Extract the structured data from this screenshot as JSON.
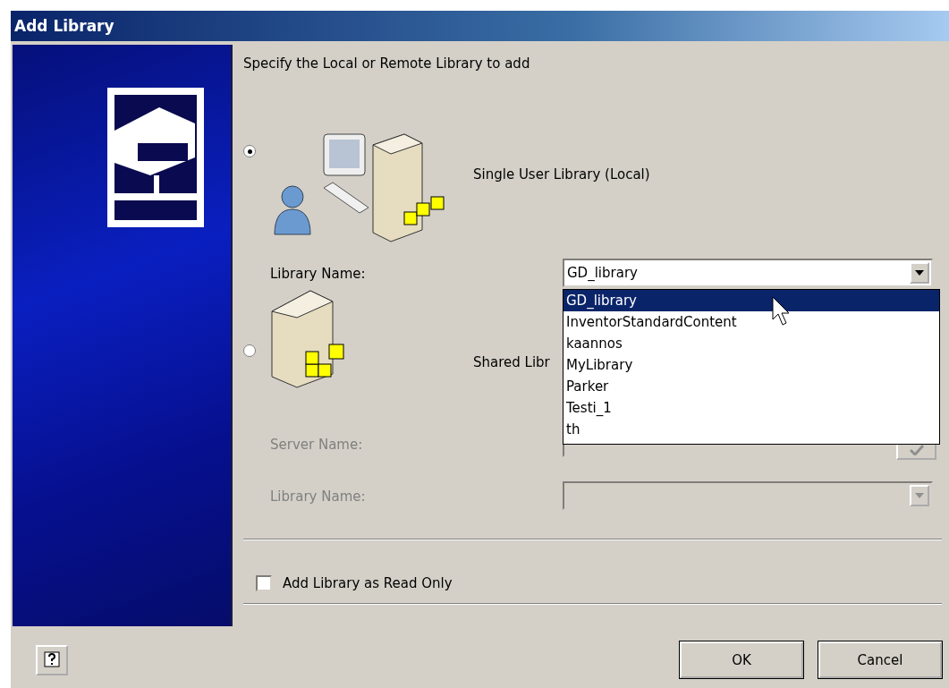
{
  "window": {
    "title": "Add Library"
  },
  "instruction": "Specify the Local or Remote Library to add",
  "options": [
    {
      "kind": "local",
      "label": "Single User Library (Local)",
      "selected": true
    },
    {
      "kind": "shared",
      "label": "Shared Libr",
      "selected": false
    }
  ],
  "local_library": {
    "label": "Library Name:",
    "value": "GD_library",
    "expanded": true,
    "list": [
      {
        "label": "GD_library",
        "selected": true
      },
      {
        "label": "InventorStandardContent",
        "selected": false
      },
      {
        "label": "kaannos",
        "selected": false
      },
      {
        "label": "MyLibrary",
        "selected": false
      },
      {
        "label": "Parker",
        "selected": false
      },
      {
        "label": "Testi_1",
        "selected": false
      },
      {
        "label": "th",
        "selected": false
      }
    ]
  },
  "server": {
    "label": "Server Name:",
    "disabled": true
  },
  "shared_library": {
    "label": "Library Name:",
    "disabled": true
  },
  "read_only": {
    "label": "Add Library as Read Only",
    "checked": false
  },
  "buttons": [
    "OK",
    "Cancel"
  ]
}
